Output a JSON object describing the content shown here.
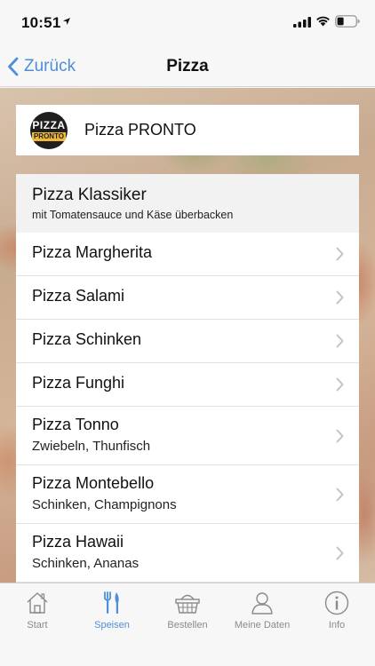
{
  "status_bar": {
    "time": "10:51"
  },
  "nav": {
    "back_label": "Zurück",
    "title": "Pizza"
  },
  "restaurant": {
    "logo_top": "PIZZA",
    "logo_bottom": "PRONTO",
    "name": "Pizza PRONTO"
  },
  "category": {
    "title": "Pizza Klassiker",
    "subtitle": "mit Tomatensauce und Käse überbacken"
  },
  "items": [
    {
      "title": "Pizza Margherita",
      "subtitle": ""
    },
    {
      "title": "Pizza Salami",
      "subtitle": ""
    },
    {
      "title": "Pizza Schinken",
      "subtitle": ""
    },
    {
      "title": "Pizza Funghi",
      "subtitle": ""
    },
    {
      "title": "Pizza Tonno",
      "subtitle": "Zwiebeln, Thunfisch"
    },
    {
      "title": "Pizza Montebello",
      "subtitle": "Schinken, Champignons"
    },
    {
      "title": "Pizza Hawaii",
      "subtitle": "Schinken, Ananas"
    }
  ],
  "tabs": [
    {
      "label": "Start",
      "icon": "home-icon"
    },
    {
      "label": "Speisen",
      "icon": "cutlery-icon"
    },
    {
      "label": "Bestellen",
      "icon": "basket-icon"
    },
    {
      "label": "Meine Daten",
      "icon": "person-icon"
    },
    {
      "label": "Info",
      "icon": "info-icon"
    }
  ],
  "active_tab": "Speisen",
  "colors": {
    "accent": "#4d8fd8",
    "inactive": "#8a8a8a",
    "logo_yellow": "#f0b93a"
  }
}
